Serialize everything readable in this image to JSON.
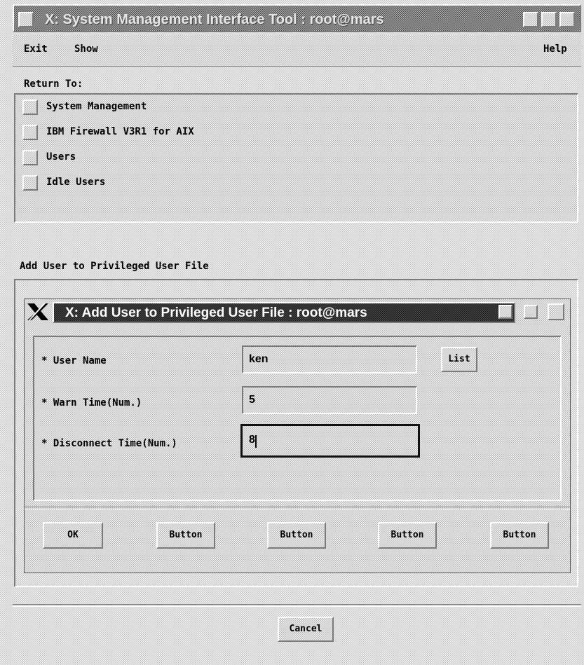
{
  "main_window": {
    "title": "X: System Management Interface Tool : root@mars"
  },
  "menubar": {
    "exit": "Exit",
    "show": "Show",
    "help": "Help"
  },
  "return_to": {
    "label": "Return To:",
    "items": [
      {
        "label": "System Management"
      },
      {
        "label": "IBM Firewall V3R1 for AIX"
      },
      {
        "label": "Users"
      },
      {
        "label": "Idle Users"
      }
    ]
  },
  "section": {
    "label": "Add User to Privileged User File"
  },
  "dialog": {
    "title": "X: Add User to Privileged User File : root@mars",
    "fields": [
      {
        "label": "* User Name",
        "value": "ken"
      },
      {
        "label": "* Warn Time(Num.)",
        "value": "5"
      },
      {
        "label": "* Disconnect Time(Num.)",
        "value": "8"
      }
    ],
    "list_button": "List",
    "buttons": [
      "OK",
      "Button",
      "Button",
      "Button",
      "Button"
    ]
  },
  "cancel_button": "Cancel",
  "icons": {
    "window_menu": "window-menu-icon",
    "minimize": "minimize-icon",
    "maximize": "maximize-icon",
    "close_x": "x-logo-icon"
  }
}
